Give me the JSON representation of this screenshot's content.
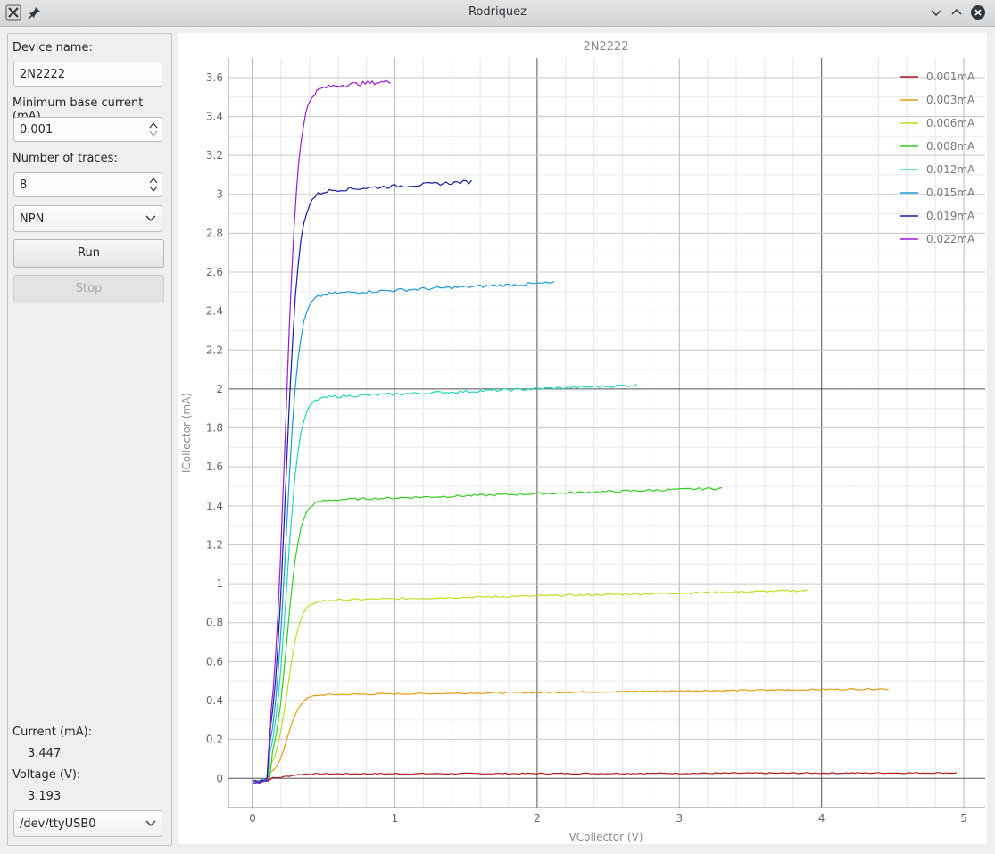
{
  "window": {
    "title": "Rodriquez"
  },
  "sidebar": {
    "device_name_label": "Device name:",
    "device_name_value": "2N2222",
    "min_base_label": "Minimum base current (mA)",
    "min_base_value": "0.001",
    "traces_label": "Number of traces:",
    "traces_value": "8",
    "type_value": "NPN",
    "run_label": "Run",
    "stop_label": "Stop",
    "current_label": "Current (mA):",
    "current_value": "3.447",
    "voltage_label": "Voltage (V):",
    "voltage_value": "3.193",
    "port_value": "/dev/ttyUSB0"
  },
  "chart_data": {
    "type": "line",
    "title": "2N2222",
    "xlabel": "VCollector (V)",
    "ylabel": "ICollector (mA)",
    "xlim": [
      -0.17,
      5.15
    ],
    "ylim": [
      -0.15,
      3.7
    ],
    "xticks": [
      "0",
      "1",
      "2",
      "3",
      "4",
      "5"
    ],
    "yticks": [
      "0",
      "0.2",
      "0.4",
      "0.6",
      "0.8",
      "1",
      "1.2",
      "1.4",
      "1.6",
      "1.8",
      "2",
      "2.2",
      "2.4",
      "2.6",
      "2.8",
      "3",
      "3.2",
      "3.4",
      "3.6"
    ],
    "legend_position": "top-right",
    "series": [
      {
        "name": "0.001mA",
        "color": "#b01a1a",
        "sat": 0.023,
        "end": 0.028,
        "vmax": 4.95
      },
      {
        "name": "0.003mA",
        "color": "#e69a10",
        "sat": 0.43,
        "end": 0.46,
        "vmax": 4.47
      },
      {
        "name": "0.006mA",
        "color": "#b8e020",
        "sat": 0.915,
        "end": 0.965,
        "vmax": 3.9
      },
      {
        "name": "0.008mA",
        "color": "#33cc22",
        "sat": 1.43,
        "end": 1.49,
        "vmax": 3.3
      },
      {
        "name": "0.012mA",
        "color": "#22d6b8",
        "sat": 1.96,
        "end": 2.02,
        "vmax": 2.7
      },
      {
        "name": "0.015mA",
        "color": "#1a9ad6",
        "sat": 2.49,
        "end": 2.545,
        "vmax": 2.12
      },
      {
        "name": "0.019mA",
        "color": "#141ba8",
        "sat": 3.02,
        "end": 3.065,
        "vmax": 1.54
      },
      {
        "name": "0.022mA",
        "color": "#9a1ad6",
        "sat": 3.555,
        "end": 3.58,
        "vmax": 0.97
      }
    ]
  }
}
